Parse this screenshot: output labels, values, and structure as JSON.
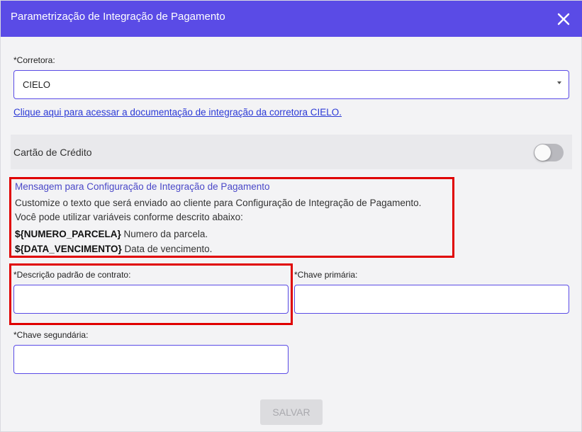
{
  "header": {
    "title": "Parametrização de Integração de Pagamento"
  },
  "corretora": {
    "label": "*Corretora:",
    "value": "CIELO"
  },
  "doc_link": "Clique aqui para acessar a documentação de integração da corretora CIELO.",
  "payment_card": {
    "label": "Cartão de Crédito",
    "enabled": false
  },
  "message": {
    "title": "Mensagem para Configuração de Integração de Pagamento",
    "line1": "Customize o texto que será enviado ao cliente para Configuração de Integração de Pagamento.",
    "line2": "Você pode utilizar variáveis conforme descrito abaixo:",
    "vars": [
      {
        "name": "${NUMERO_PARCELA}",
        "desc": "Numero da parcela."
      },
      {
        "name": "${DATA_VENCIMENTO}",
        "desc": "Data de vencimento."
      }
    ]
  },
  "fields": {
    "descricao": {
      "label": "*Descrição padrão de contrato:",
      "value": ""
    },
    "chave_primaria": {
      "label": "*Chave primária:",
      "value": ""
    },
    "chave_secundaria": {
      "label": "*Chave segundária:",
      "value": ""
    }
  },
  "save_label": "SALVAR",
  "colors": {
    "accent": "#5a4be6",
    "highlight": "#e00000",
    "link": "#2c3ad6"
  },
  "icons": {
    "close": "close-icon",
    "select_caret": "caret-down-icon"
  }
}
